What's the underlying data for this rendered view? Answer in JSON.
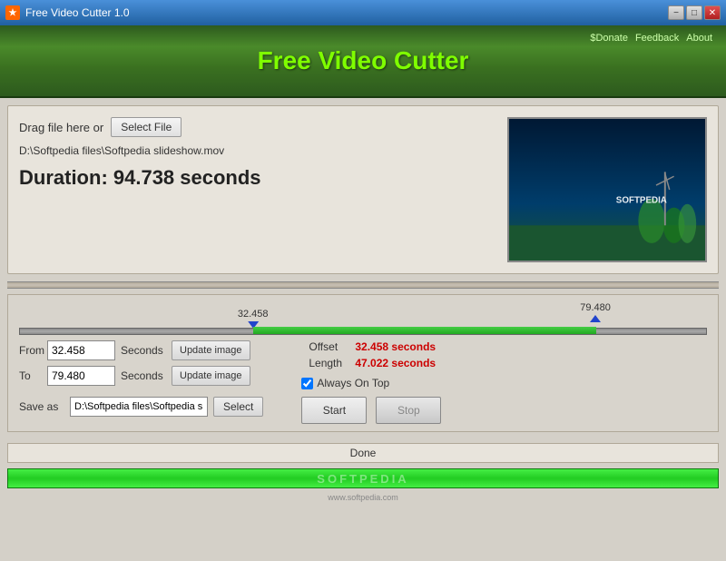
{
  "titleBar": {
    "icon": "★",
    "title": "Free Video Cutter 1.0",
    "minimize": "−",
    "maximize": "□",
    "close": "✕"
  },
  "header": {
    "title": "Free Video Cutter",
    "links": [
      "$Donate",
      "Feedback",
      "About"
    ]
  },
  "fileSection": {
    "dragLabel": "Drag file here or",
    "selectFileBtn": "Select File",
    "filePath": "D:\\Softpedia files\\Softpedia slideshow.mov",
    "durationLabel": "Duration: 94.738 seconds"
  },
  "timeline": {
    "leftMarkerLabel": "32.458",
    "rightMarkerLabel": "79.480",
    "leftPercent": 34,
    "rightPercent": 84
  },
  "controls": {
    "fromLabel": "From",
    "fromValue": "32.458",
    "toLabel": "To",
    "toValue": "79.480",
    "secondsLabel1": "Seconds",
    "secondsLabel2": "Seconds",
    "updateBtn1": "Update image",
    "updateBtn2": "Update image",
    "offsetLabel": "Offset",
    "offsetValue": "32.458 seconds",
    "lengthLabel": "Length",
    "lengthValue": "47.022 seconds",
    "alwaysOnTop": "Always On Top",
    "startBtn": "Start",
    "stopBtn": "Stop",
    "saveAsLabel": "Save as",
    "savePath": "D:\\Softpedia files\\Softpedia slideshow_cut.mov",
    "selectBtn": "Select"
  },
  "statusBar": {
    "text": "Done"
  },
  "progress": {
    "text": "SOFTPEDIA"
  },
  "credit": {
    "text": "www.softpedia.com"
  }
}
